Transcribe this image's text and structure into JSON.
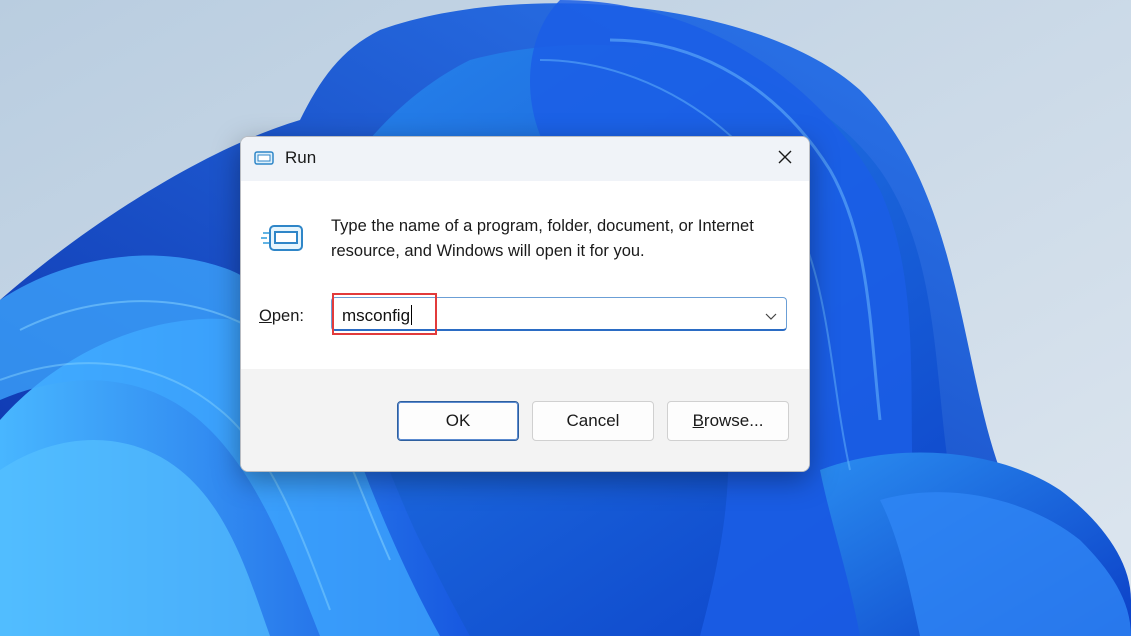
{
  "dialog": {
    "title": "Run",
    "icon": "run-icon",
    "close_icon": "close-icon",
    "description": "Type the name of a program, folder, document, or Internet resource, and Windows will open it for you.",
    "open_label_underlined": "O",
    "open_label_rest": "pen:",
    "input_value": "msconfig",
    "dropdown_icon": "chevron-down-icon",
    "buttons": {
      "ok": "OK",
      "cancel": "Cancel",
      "browse_underlined": "B",
      "browse_rest": "rowse..."
    }
  },
  "colors": {
    "highlight": "#e23b3b",
    "accent": "#2b6cc4",
    "wallpaper_blue": "#1a4fd8"
  }
}
